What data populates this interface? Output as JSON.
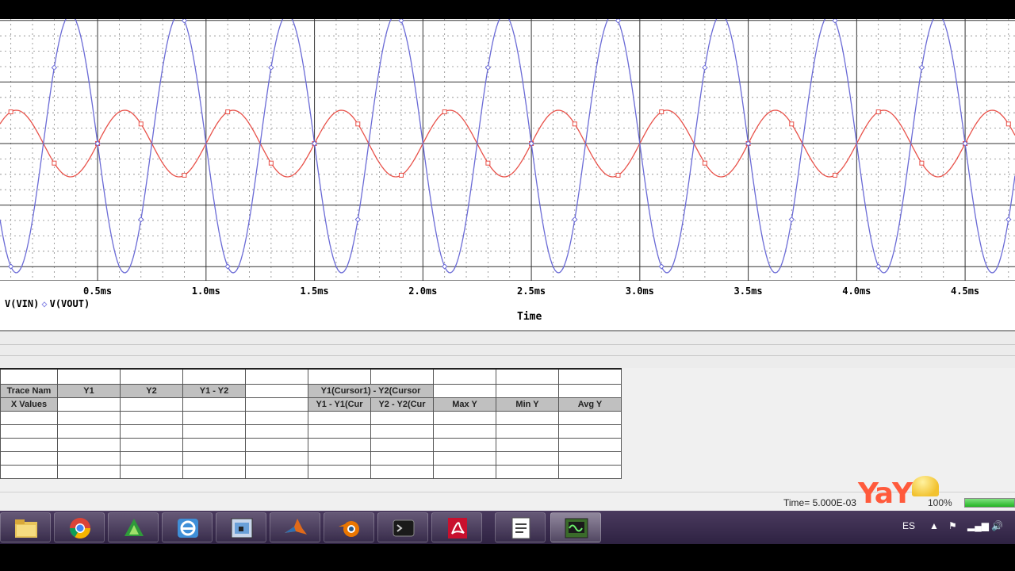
{
  "chart_data": {
    "type": "line",
    "xlabel": "Time",
    "x_ticks": [
      "0.5ms",
      "1.0ms",
      "1.5ms",
      "2.0ms",
      "2.5ms",
      "3.0ms",
      "3.5ms",
      "4.0ms",
      "4.5ms"
    ],
    "x_tick_values": [
      0.5,
      1.0,
      1.5,
      2.0,
      2.5,
      3.0,
      3.5,
      4.0,
      4.5
    ],
    "xlim": [
      0.05,
      4.73
    ],
    "grid": true,
    "series": [
      {
        "name": "V(VIN)",
        "color": "#e8524a",
        "frequency_khz": 2,
        "amplitude": 1,
        "phase": "sine",
        "marker": "square"
      },
      {
        "name": "V(VOUT)",
        "color": "#6b6bd6",
        "frequency_khz": 2,
        "amplitude": 3.9,
        "phase": "inverted sine",
        "marker": "diamond"
      }
    ]
  },
  "legend": {
    "vin": "V(VIN)",
    "vout": "V(VOUT)",
    "sep": "◇"
  },
  "probe_table": {
    "row1": [
      "Trace Nam",
      "Y1",
      "Y2",
      "Y1 - Y2",
      "",
      "Y1(Cursor1) - Y2(Cursor",
      "",
      "",
      ""
    ],
    "row2": [
      "X Values",
      "",
      "",
      "",
      "",
      "Y1 - Y1(Cur",
      "Y2 - Y2(Cur",
      "Max Y",
      "Min Y",
      "Avg Y"
    ]
  },
  "status": {
    "time": "Time= 5.000E-03",
    "percent": "100%",
    "progress_fraction": 1.0
  },
  "watermark": "YaY",
  "taskbar": {
    "apps": [
      "file-explorer",
      "chrome",
      "sketchup",
      "internet-explorer",
      "tool-app",
      "matlab",
      "blender",
      "terminal",
      "acrobat",
      "text-editor",
      "pspice"
    ],
    "tray": {
      "lang": "ES"
    }
  }
}
